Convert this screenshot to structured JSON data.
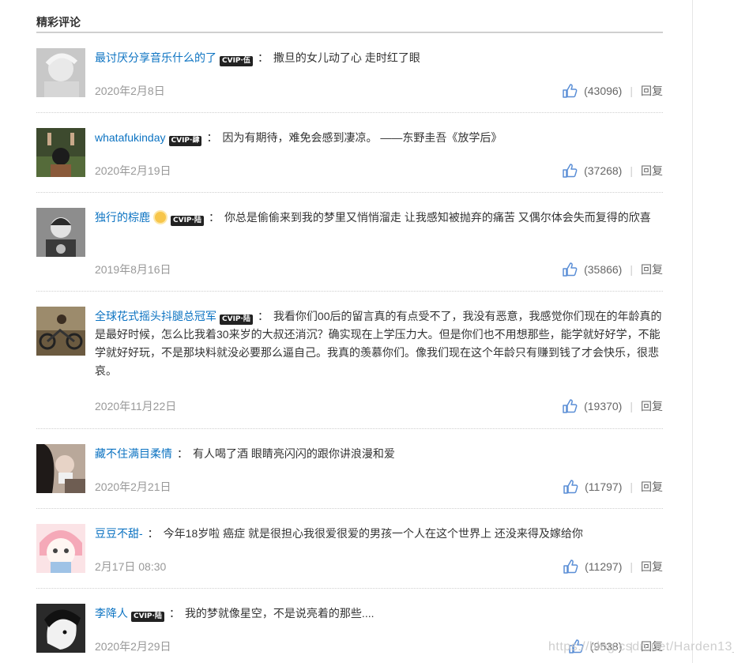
{
  "section": {
    "title": "精彩评论"
  },
  "comments": [
    {
      "user": "最讨厌分享音乐什么的了",
      "vip": "CVIP·伍",
      "text": "撒旦的女儿动了心 走时红了眼",
      "date": "2020年2月8日",
      "likes": "(43096)",
      "reply": "回复"
    },
    {
      "user": "whatafukinday",
      "vip": "CVIP·肆",
      "text": "因为有期待，难免会感到凄凉。 ——东野圭吾《放学后》",
      "date": "2020年2月19日",
      "likes": "(37268)",
      "reply": "回复"
    },
    {
      "user": "独行的棕鹿",
      "vip": "CVIP·陆",
      "text": "你总是偷偷来到我的梦里又悄悄溜走 让我感知被抛弃的痛苦 又偶尔体会失而复得的欣喜",
      "date": "2019年8月16日",
      "likes": "(35866)",
      "reply": "回复"
    },
    {
      "user": "全球花式摇头抖腿总冠军",
      "vip": "CVIP·陆",
      "text": "我看你们00后的留言真的有点受不了，我没有恶意，我感觉你们现在的年龄真的是最好时候，怎么比我着30来岁的大叔还消沉？确实现在上学压力大。但是你们也不用想那些，能学就好好学，不能学就好好玩，不是那块料就没必要那么逼自己。我真的羡慕你们。像我们现在这个年龄只有赚到钱了才会快乐，很悲哀。",
      "date": "2020年11月22日",
      "likes": "(19370)",
      "reply": "回复"
    },
    {
      "user": "藏不住满目柔情",
      "vip": "",
      "text": "有人喝了酒 眼睛亮闪闪的跟你讲浪漫和爱",
      "date": "2020年2月21日",
      "likes": "(11797)",
      "reply": "回复"
    },
    {
      "user": "豆豆不甜-",
      "vip": "",
      "text": "今年18岁啦 癌症 就是很担心我很爱很爱的男孩一个人在这个世界上 还没来得及嫁给你",
      "date": "2月17日 08:30",
      "likes": "(11297)",
      "reply": "回复"
    },
    {
      "user": "李降人",
      "vip": "CVIP·陆",
      "text": "我的梦就像星空，不是说亮着的那些....",
      "date": "2020年2月29日",
      "likes": "(9538)",
      "reply": "回复"
    }
  ],
  "watermark": "https://blog.csdn.net/Harden13_",
  "colors": {
    "link": "#0c73c2",
    "like": "#5a8ed6",
    "muted": "#999999"
  }
}
